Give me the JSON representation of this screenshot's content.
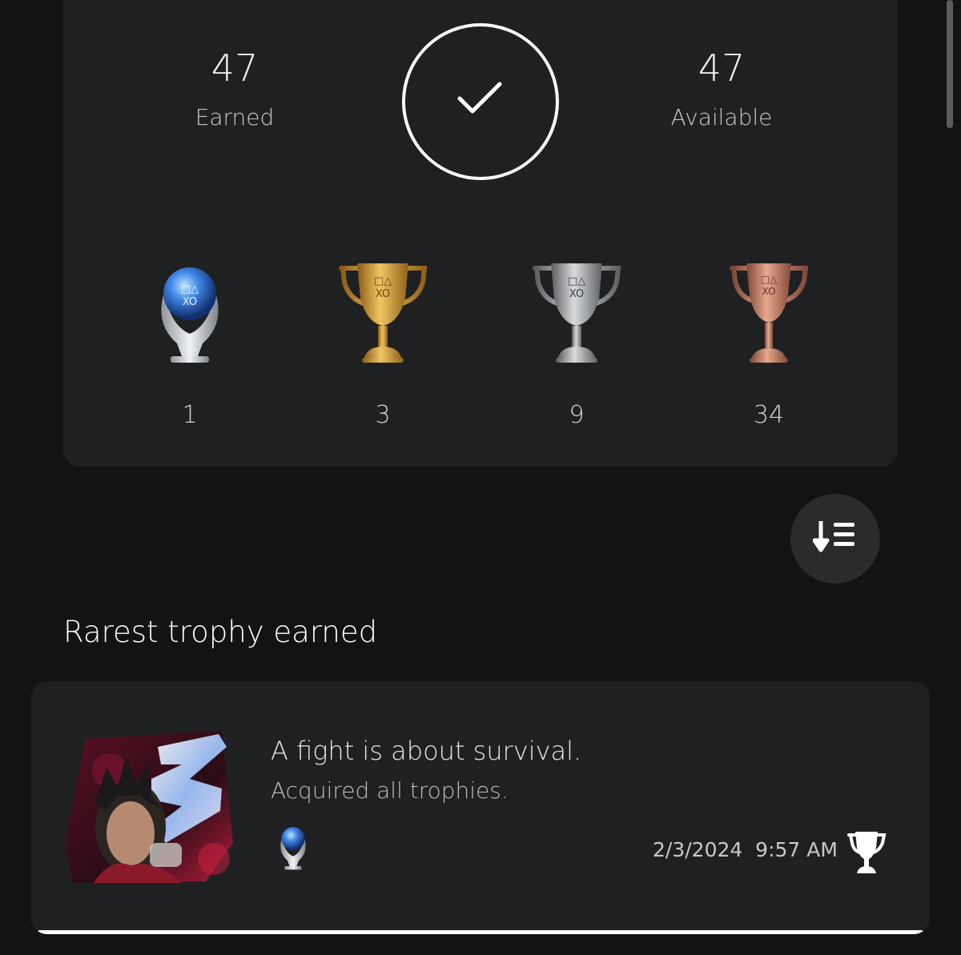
{
  "summary": {
    "earned_count": "47",
    "earned_label": "Earned",
    "available_count": "47",
    "available_label": "Available",
    "completion_icon": "checkmark-icon"
  },
  "trophies": [
    {
      "type": "platinum",
      "count": "1",
      "icon": "platinum-trophy-icon",
      "color": "#3a7bd5"
    },
    {
      "type": "gold",
      "count": "3",
      "icon": "gold-trophy-icon",
      "color": "#d9a441"
    },
    {
      "type": "silver",
      "count": "9",
      "icon": "silver-trophy-icon",
      "color": "#a8a8a8"
    },
    {
      "type": "bronze",
      "count": "34",
      "icon": "bronze-trophy-icon",
      "color": "#c98466"
    }
  ],
  "sort_button_icon": "sort-descending-icon",
  "rarest": {
    "section_title": "Rarest trophy earned",
    "name": "A fight is about survival.",
    "description": "Acquired all trophies.",
    "earned_at": "2/3/2024  9:57 AM",
    "trophy_icon": "platinum-trophy-icon",
    "earned_icon": "trophy-cup-icon"
  },
  "colors": {
    "background": "#121314",
    "card": "#1f2022",
    "sort_button": "#2a2b2d"
  }
}
